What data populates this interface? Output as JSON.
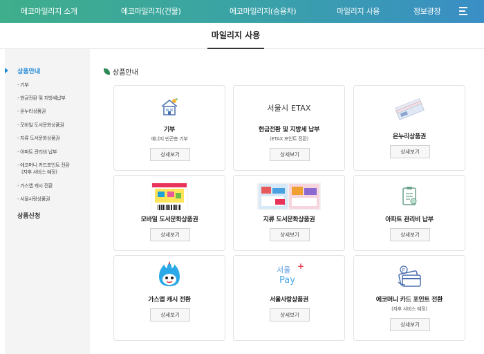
{
  "nav": {
    "items": [
      "에코마일리지 소개",
      "에코마일리지(건물)",
      "에코마일리지(승용차)",
      "마일리지 사용",
      "정보광장"
    ]
  },
  "subhead": {
    "title": "마일리지 사용"
  },
  "sidebar": {
    "main": [
      "상품안내",
      "상품신청"
    ],
    "sub": [
      "- 기부",
      "- 현금전환 및 지방세납부",
      "- 온누리상품권",
      "- 모바일 도서문화상품권",
      "- 지류 도서문화상품권",
      "- 아파트 관리비 납부",
      "- 에코머니 카드포인트 전환",
      "(자후 서비스 예정)",
      "- 가스앱 캐시 전환",
      "- 서울사랑상품권"
    ]
  },
  "section": {
    "title": "상품안내"
  },
  "cards": [
    {
      "title": "기부",
      "desc": "에너지 빈곤층 기부",
      "button": "상세보기"
    },
    {
      "title": "현금전환 및 지방세 납부",
      "desc": "(ETAX 포인트 전환)",
      "button": "상세보기",
      "logo_text": "서울시 ETAX"
    },
    {
      "title": "온누리상품권",
      "desc": "",
      "button": "상세보기"
    },
    {
      "title": "모바일 도서문화상품권",
      "desc": "",
      "button": "상세보기"
    },
    {
      "title": "지류 도서문화상품권",
      "desc": "",
      "button": "상세보기"
    },
    {
      "title": "아파트 관리비 납부",
      "desc": "",
      "button": "상세보기"
    },
    {
      "title": "가스앱 캐시 전환",
      "desc": "",
      "button": "상세보기"
    },
    {
      "title": "서울사랑상품권",
      "desc": "",
      "button": "상세보기",
      "logo_text": "서울",
      "logo_text2": "Pay"
    },
    {
      "title": "에코머니 카드 포인트 전환",
      "desc": "(자후 서비스 예정)",
      "button": "상세보기"
    }
  ],
  "colors": {
    "accent": "#1e88d6",
    "nav_start": "#3fae8b",
    "nav_end": "#3a8ec5"
  }
}
